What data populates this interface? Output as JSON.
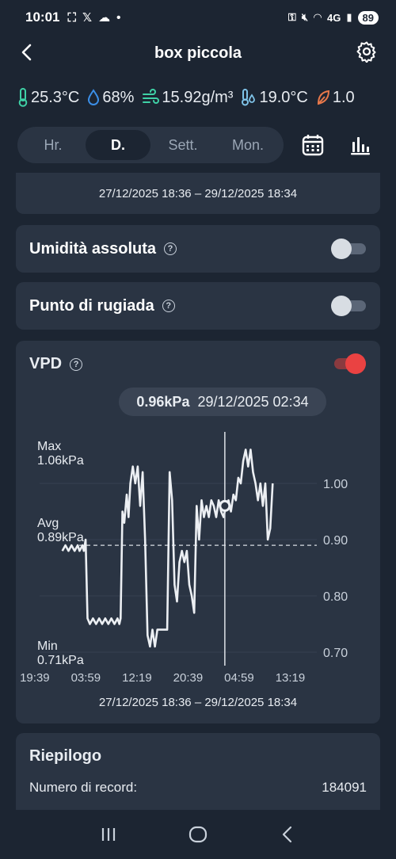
{
  "status": {
    "time": "10:01",
    "battery": "89",
    "network": "4G"
  },
  "header": {
    "title": "box piccola"
  },
  "metrics": [
    {
      "icon": "thermometer-icon",
      "value": "25.3°C",
      "color": "#3fd1a6"
    },
    {
      "icon": "water-drop-icon",
      "value": "68%",
      "color": "#3b8fe8"
    },
    {
      "icon": "wind-icon",
      "value": "15.92g/m³",
      "color": "#3fd1a6"
    },
    {
      "icon": "dew-point-icon",
      "value": "19.0°C",
      "color": "#7fc3e8"
    },
    {
      "icon": "leaf-icon",
      "value": "1.0",
      "color": "#e8784a"
    }
  ],
  "tabs": [
    "Hr.",
    "D.",
    "Sett.",
    "Mon."
  ],
  "active_tab": "D.",
  "date_range": "27/12/2025 18:36 – 29/12/2025 18:34",
  "toggles": {
    "umidita": {
      "label": "Umidità assoluta",
      "on": false
    },
    "rugiada": {
      "label": "Punto di rugiada",
      "on": false
    },
    "vpd": {
      "label": "VPD",
      "on": true
    }
  },
  "vpd": {
    "tooltip_value": "0.96kPa",
    "tooltip_time": "29/12/2025 02:34",
    "max_label": "Max",
    "max_value": "1.06kPa",
    "avg_label": "Avg",
    "avg_value": "0.89kPa",
    "min_label": "Min",
    "min_value": "0.71kPa"
  },
  "chart_data": {
    "type": "line",
    "ylim": [
      0.7,
      1.06
    ],
    "yticks": [
      "1.00",
      "0.90",
      "0.80",
      "0.70"
    ],
    "yticks_values": [
      1.0,
      0.9,
      0.8,
      0.7
    ],
    "xticks": [
      "19:39",
      "03:59",
      "12:19",
      "20:39",
      "04:59",
      "13:19"
    ],
    "x_range_hours": [
      -0.5,
      46
    ],
    "xticks_hours": [
      0,
      8.33,
      16.67,
      25,
      33.33,
      41.67
    ],
    "avg": 0.89,
    "cursor_x_hours": 31,
    "cursor_y": 0.96,
    "series": [
      {
        "x": [
          4.5,
          5.0,
          5.5,
          6.0,
          6.5,
          7.0,
          7.3,
          7.8,
          8.0,
          8.3,
          8.6,
          9.0,
          9.5,
          10.0,
          10.5,
          11.0,
          11.5,
          12.0,
          12.5,
          13.0,
          13.5,
          13.8,
          14.0,
          14.3,
          14.6,
          15.0,
          15.3,
          15.6,
          16.0,
          16.4,
          16.8,
          17.2,
          17.6,
          18.0,
          18.4,
          18.8,
          19.2,
          19.6,
          20.0,
          20.4,
          20.8,
          21.2,
          21.6,
          22.0,
          22.4,
          22.8,
          23.2,
          23.6,
          24.0,
          24.4,
          24.8,
          25.2,
          25.6,
          26.0,
          26.4,
          26.8,
          27.2,
          27.6,
          28.0,
          28.4,
          28.8,
          29.2,
          29.6,
          30.0,
          30.4,
          30.8,
          31.2,
          31.6,
          32.0,
          32.4,
          32.8,
          33.2,
          33.6,
          34.0,
          34.4,
          34.8,
          35.2,
          35.6,
          36.0,
          36.4,
          36.8,
          37.2,
          37.6,
          38.0,
          38.4,
          38.8
        ],
        "values": [
          0.88,
          0.89,
          0.88,
          0.89,
          0.88,
          0.89,
          0.88,
          0.89,
          0.88,
          0.9,
          0.76,
          0.75,
          0.76,
          0.75,
          0.76,
          0.75,
          0.76,
          0.75,
          0.76,
          0.75,
          0.76,
          0.75,
          0.76,
          0.95,
          0.93,
          0.98,
          0.94,
          1.0,
          1.03,
          1.0,
          1.03,
          0.96,
          1.02,
          0.9,
          0.73,
          0.71,
          0.74,
          0.71,
          0.74,
          0.74,
          0.74,
          0.74,
          0.74,
          1.02,
          0.97,
          0.82,
          0.79,
          0.86,
          0.88,
          0.86,
          0.88,
          0.82,
          0.8,
          0.77,
          0.96,
          0.9,
          0.97,
          0.94,
          0.96,
          0.94,
          0.97,
          0.96,
          0.94,
          0.97,
          0.95,
          0.94,
          0.96,
          0.97,
          0.95,
          0.98,
          0.97,
          1.01,
          1.0,
          1.04,
          1.06,
          1.03,
          1.06,
          1.02,
          1.0,
          0.97,
          1.0,
          0.96,
          1.0,
          0.9,
          0.92,
          1.0
        ]
      }
    ]
  },
  "summary": {
    "title": "Riepilogo",
    "records_label": "Numero di record:",
    "records_value": "184091"
  }
}
